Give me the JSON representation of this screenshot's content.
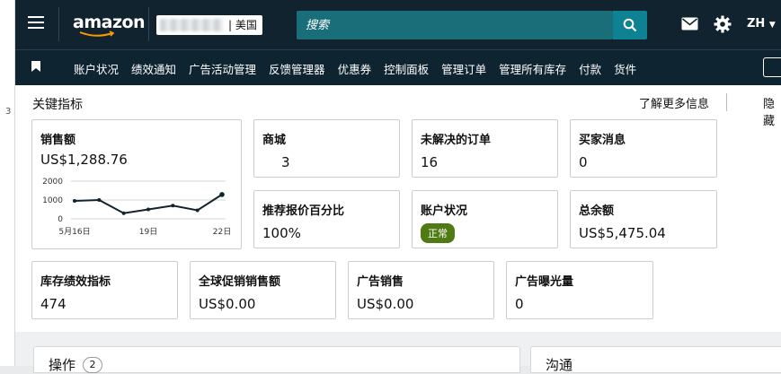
{
  "sidebar_number": "3",
  "header": {
    "logo": "amazon",
    "store_region": "| 美国",
    "search_placeholder": "搜索",
    "language": "ZH"
  },
  "nav": {
    "items": [
      "账户状况",
      "绩效通知",
      "广告活动管理",
      "反馈管理器",
      "优惠券",
      "控制面板",
      "管理订单",
      "管理所有库存",
      "付款",
      "货件"
    ]
  },
  "metrics": {
    "section_title": "关键指标",
    "learn_more": "了解更多信息",
    "hide": "隐藏",
    "sales": {
      "label": "销售额",
      "value": "US$1,288.76"
    },
    "mall": {
      "label": "商城",
      "value": "3"
    },
    "unresolved_orders": {
      "label": "未解决的订单",
      "value": "16"
    },
    "buyer_messages": {
      "label": "买家消息",
      "value": "0"
    },
    "featured_offer": {
      "label": "推荐报价百分比",
      "value": "100%"
    },
    "account_health": {
      "label": "账户状况",
      "status": "正常"
    },
    "total_balance": {
      "label": "总余额",
      "value": "US$5,475.04"
    },
    "inventory_performance": {
      "label": "库存绩效指标",
      "value": "474"
    },
    "global_promo_sales": {
      "label": "全球促销销售额",
      "value": "US$0.00"
    },
    "ad_sales": {
      "label": "广告销售",
      "value": "US$0.00"
    },
    "ad_impressions": {
      "label": "广告曝光量",
      "value": "0"
    }
  },
  "chart_data": {
    "type": "line",
    "x": [
      16,
      17,
      18,
      19,
      20,
      21,
      22
    ],
    "values": [
      950,
      1000,
      300,
      500,
      700,
      450,
      1288.76
    ],
    "x_tick_labels": [
      "5月16日",
      "19日",
      "22日"
    ],
    "x_tick_positions": [
      16,
      19,
      22
    ],
    "y_ticks": [
      "2000",
      "1000",
      "0"
    ],
    "ylim": [
      0,
      2000
    ],
    "grid": true,
    "colors": {
      "line": "#10232e",
      "grid": "#d5d9d9"
    }
  },
  "bottom": {
    "actions_title": "操作",
    "actions_count": "2",
    "communication_title": "沟通"
  }
}
